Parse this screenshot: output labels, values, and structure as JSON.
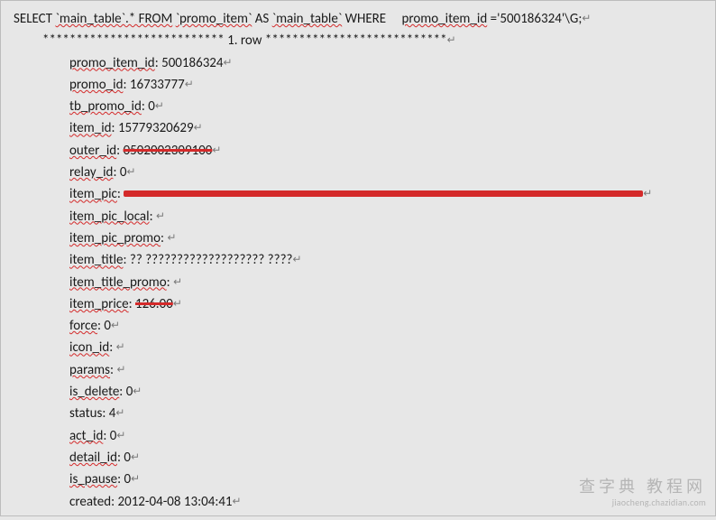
{
  "query": {
    "select": "SELECT",
    "maintable_star": "`main_table`.* FROM",
    "promo_item": "`promo_item`",
    "as": "AS",
    "maintable": "`main_table`",
    "where": "WHERE",
    "field": "promo_item_id",
    "eqval": "='500186324'\\G;"
  },
  "separator": {
    "stars_left": "***************************",
    "row_label": "1. row",
    "stars_right": "***************************"
  },
  "fields": {
    "promo_item_id": {
      "label": "promo_item_id",
      "value": "500186324"
    },
    "promo_id": {
      "label": "promo_id",
      "value": "16733777"
    },
    "tb_promo_id": {
      "label": "tb_promo_id",
      "value": "0"
    },
    "item_id": {
      "label": "item_id",
      "value": "15779320629"
    },
    "outer_id": {
      "label": "outer_id",
      "value_struck": "0502002309100"
    },
    "relay_id": {
      "label": "relay_id",
      "value": "0"
    },
    "item_pic": {
      "label": "item_pic"
    },
    "item_pic_local": {
      "label": "item_pic_local"
    },
    "item_pic_promo": {
      "label": "item_pic_promo"
    },
    "item_title": {
      "label": "item_title",
      "value": "?? ??????????????????? ????"
    },
    "item_title_promo": {
      "label": "item_title_promo"
    },
    "item_price": {
      "label": "item_price",
      "value_struck": "126.00"
    },
    "force": {
      "label": "force",
      "value": "0"
    },
    "icon_id": {
      "label": "icon_id"
    },
    "params": {
      "label": "params"
    },
    "is_delete": {
      "label": "is_delete",
      "value": "0"
    },
    "status": {
      "label": "status",
      "value": "4"
    },
    "act_id": {
      "label": "act_id",
      "value": "0"
    },
    "detail_id": {
      "label": "detail_id",
      "value": "0"
    },
    "is_pause": {
      "label": "is_pause",
      "value": "0"
    },
    "created": {
      "label": "created",
      "value": "2012-04-08 13:04:41"
    }
  },
  "watermark": {
    "cn": "查字典 教程网",
    "en": "jiaocheng.chazidian.com"
  },
  "cr": "↵"
}
